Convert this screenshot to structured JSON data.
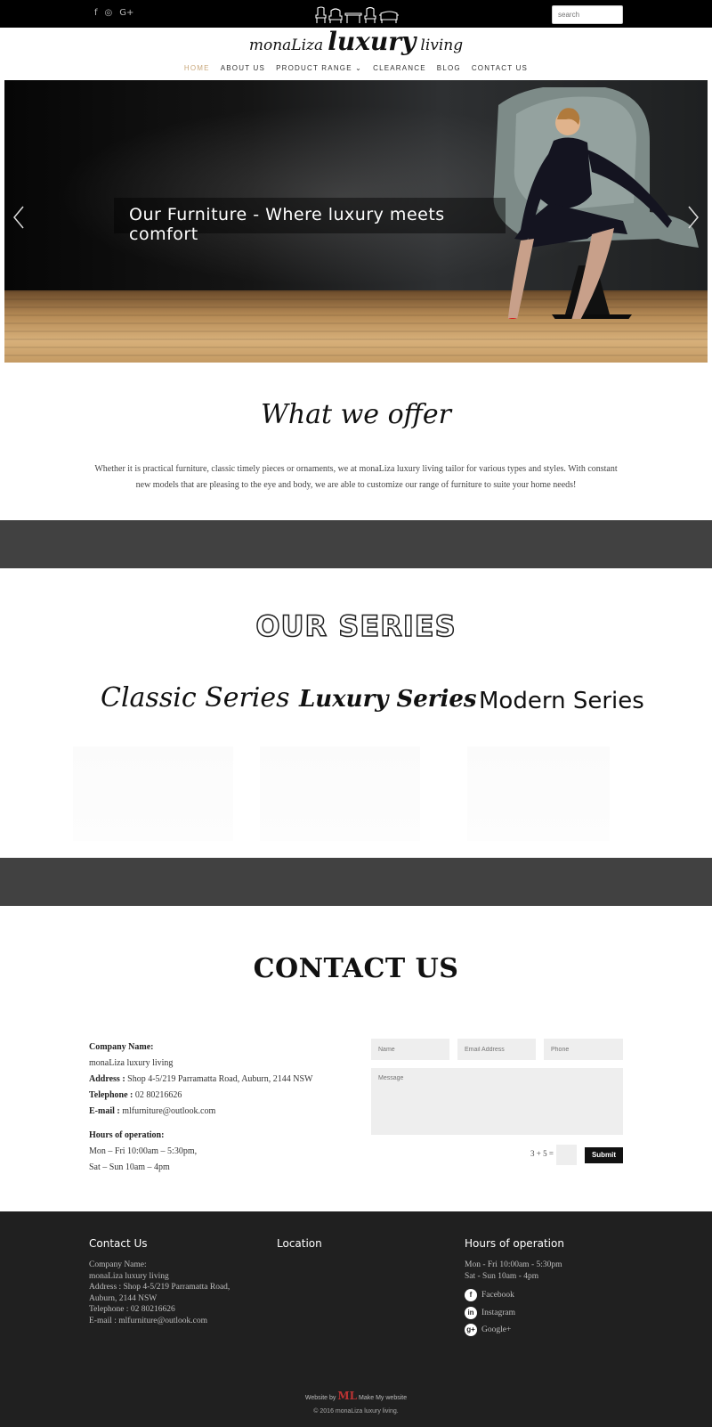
{
  "topbar": {
    "social": [
      "f",
      "◎",
      "G+"
    ],
    "search_placeholder": "search"
  },
  "logo": {
    "part1": "monaLiza",
    "part2": "luxury",
    "part3": "living"
  },
  "nav": {
    "items": [
      "HOME",
      "ABOUT US",
      "PRODUCT RANGE ⌄",
      "CLEARANCE",
      "BLOG",
      "CONTACT US"
    ],
    "active": "HOME"
  },
  "hero": {
    "caption": "Our Furniture - Where luxury meets comfort"
  },
  "offer": {
    "title": "What we offer",
    "text": "Whether it is practical furniture, classic timely pieces or ornaments, we at monaLiza luxury living tailor for various types and styles. With constant new models that are pleasing to the eye and body, we are able to customize our range of furniture to suite your home needs!"
  },
  "series": {
    "title": "OUR SERIES",
    "items": [
      "Classic Series",
      "Luxury Series",
      "Modern Series"
    ]
  },
  "contact": {
    "title": "CONTACT US",
    "company_label": "Company Name:",
    "company": "monaLiza luxury living",
    "address_label": "Address :",
    "address": "Shop 4-5/219 Parramatta Road, Auburn, 2144 NSW",
    "telephone_label": "Telephone :",
    "telephone": "02 80216626",
    "email_label": "E-mail :",
    "email": "mlfurniture@outlook.com",
    "hours_label": "Hours of operation:",
    "hours1": "Mon – Fri 10:00am – 5:30pm,",
    "hours2": "Sat – Sun 10am – 4pm",
    "form": {
      "name_placeholder": "Name",
      "email_placeholder": "Email Address",
      "phone_placeholder": "Phone",
      "message_placeholder": "Message",
      "captcha": "3 + 5 =",
      "submit": "Submit"
    }
  },
  "footer": {
    "col1_title": "Contact Us",
    "col1_lines": [
      "Company Name:",
      "monaLiza luxury living",
      "Address : Shop 4-5/219 Parramatta Road,",
      "Auburn, 2144 NSW",
      "Telephone : 02 80216626",
      "E-mail : mlfurniture@outlook.com"
    ],
    "col2_title": "Location",
    "col3_title": "Hours of operation",
    "col3_lines": [
      "Mon - Fri 10:00am - 5:30pm",
      "Sat - Sun 10am - 4pm"
    ],
    "social": [
      {
        "icon": "f",
        "label": "Facebook"
      },
      {
        "icon": "in",
        "label": "Instagram"
      },
      {
        "icon": "g+",
        "label": "Google+"
      }
    ],
    "credit_prefix": "Website by",
    "credit_logo": "ML",
    "credit_suffix": "Make My website",
    "copyright": "© 2016 monaLiza luxury living."
  },
  "colors": {
    "accent": "#c9a87c",
    "band": "#414141",
    "footer": "#202020"
  }
}
